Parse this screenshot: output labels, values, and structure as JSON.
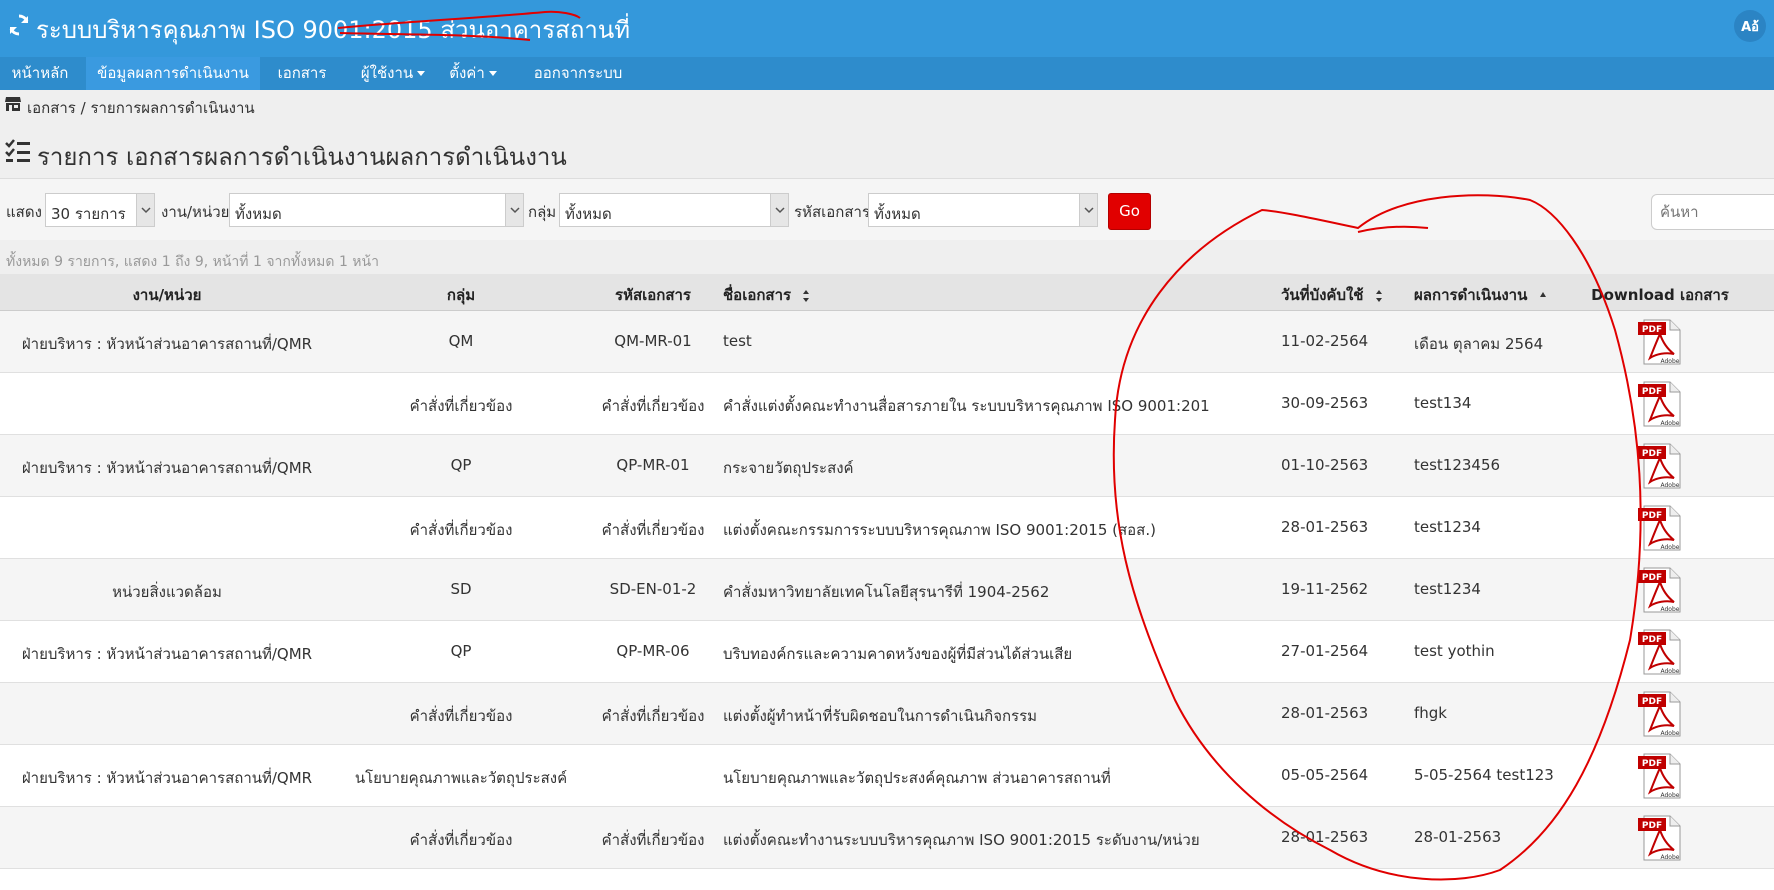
{
  "header": {
    "title": "ระบบบริหารคุณภาพ ISO 9001:2015 ส่วนอาคารสถานที่",
    "user_badge": "Aอ้"
  },
  "nav": {
    "items": [
      {
        "label": "หน้าหลัก",
        "has_caret": false,
        "active": false
      },
      {
        "label": "ข้อมูลผลการดำเนินงาน",
        "has_caret": false,
        "active": true
      },
      {
        "label": "เอกสาร",
        "has_caret": false,
        "active": false
      },
      {
        "label": "ผู้ใช้งาน",
        "has_caret": true,
        "active": false
      },
      {
        "label": "ตั้งค่า",
        "has_caret": true,
        "active": false
      },
      {
        "label": "ออกจากระบบ",
        "has_caret": false,
        "active": false
      }
    ]
  },
  "breadcrumb": "เอกสาร / รายการผลการดำเนินงาน",
  "page_title": "รายการ เอกสารผลการดำเนินงานผลการดำเนินงาน",
  "filters": {
    "show_label": "แสดง",
    "show_value": "30 รายการ",
    "unit_label": "งาน/หน่วย",
    "unit_value": "ทั้งหมด",
    "group_label": "กลุ่ม",
    "group_value": "ทั้งหมด",
    "code_label": "รหัสเอกสาร",
    "code_value": "ทั้งหมด",
    "go_label": "Go",
    "search_placeholder": "ค้นหา"
  },
  "summary": "ทั้งหมด 9 รายการ, แสดง 1 ถึง 9, หน้าที่ 1 จากทั้งหมด 1 หน้า",
  "table": {
    "headers": {
      "unit": "งาน/หน่วย",
      "group": "กลุ่ม",
      "code": "รหัสเอกสาร",
      "name": "ชื่อเอกสาร",
      "date": "วันที่บังคับใช้",
      "result": "ผลการดำเนินงาน",
      "download": "Download เอกสาร"
    },
    "rows": [
      {
        "unit": "ฝ่ายบริหาร : หัวหน้าส่วนอาคารสถานที่/QMR",
        "group": "QM",
        "code": "QM-MR-01",
        "name": "test",
        "date": "11-02-2564",
        "result": "เดือน ตุลาคม 2564"
      },
      {
        "unit": "",
        "group": "คำสั่งที่เกี่ยวข้อง",
        "code": "คำสั่งที่เกี่ยวข้อง",
        "name": "คำสั่งแต่งตั้งคณะทำงานสื่อสารภายใน ระบบบริหารคุณภาพ ISO 9001:201",
        "date": "30-09-2563",
        "result": "test134"
      },
      {
        "unit": "ฝ่ายบริหาร : หัวหน้าส่วนอาคารสถานที่/QMR",
        "group": "QP",
        "code": "QP-MR-01",
        "name": "กระจายวัตถุประสงค์",
        "date": "01-10-2563",
        "result": "test123456"
      },
      {
        "unit": "",
        "group": "คำสั่งที่เกี่ยวข้อง",
        "code": "คำสั่งที่เกี่ยวข้อง",
        "name": "แต่งตั้งคณะกรรมการระบบบริหารคุณภาพ ISO 9001:2015 (สอส.)",
        "date": "28-01-2563",
        "result": "test1234"
      },
      {
        "unit": "หน่วยสิ่งแวดล้อม",
        "group": "SD",
        "code": "SD-EN-01-2",
        "name": "คำสั่งมหาวิทยาลัยเทคโนโลยีสุรนารีที่ 1904-2562",
        "date": "19-11-2562",
        "result": "test1234"
      },
      {
        "unit": "ฝ่ายบริหาร : หัวหน้าส่วนอาคารสถานที่/QMR",
        "group": "QP",
        "code": "QP-MR-06",
        "name": "บริบทองค์กรและความคาดหวังของผู้ที่มีส่วนได้ส่วนเสีย",
        "date": "27-01-2564",
        "result": "test yothin"
      },
      {
        "unit": "",
        "group": "คำสั่งที่เกี่ยวข้อง",
        "code": "คำสั่งที่เกี่ยวข้อง",
        "name": "แต่งตั้งผู้ทำหน้าที่รับผิดชอบในการดำเนินกิจกรรม",
        "date": "28-01-2563",
        "result": "fhgk"
      },
      {
        "unit": "ฝ่ายบริหาร : หัวหน้าส่วนอาคารสถานที่/QMR",
        "group": "นโยบายคุณภาพและวัตถุประสงค์",
        "code": "",
        "name": "นโยบายคุณภาพและวัตถุประสงค์คุณภาพ ส่วนอาคารสถานที่",
        "date": "05-05-2564",
        "result": "5-05-2564 test123"
      },
      {
        "unit": "",
        "group": "คำสั่งที่เกี่ยวข้อง",
        "code": "คำสั่งที่เกี่ยวข้อง",
        "name": "แต่งตั้งคณะทำงานระบบบริหารคุณภาพ ISO 9001:2015 ระดับงาน/หน่วย",
        "date": "28-01-2563",
        "result": "28-01-2563"
      }
    ]
  },
  "pdf_icon": {
    "top_text": "PDF",
    "bottom_text": "Adobe"
  },
  "colors": {
    "header_bg": "#3498db",
    "nav_bg": "#2e8ccc",
    "go_button": "#e10000",
    "annotation": "#e00000"
  }
}
